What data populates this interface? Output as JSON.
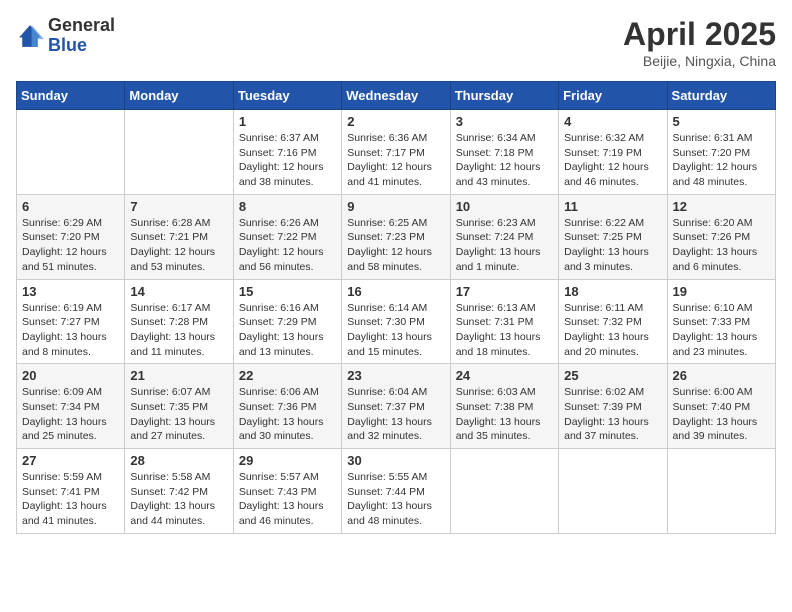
{
  "logo": {
    "general": "General",
    "blue": "Blue"
  },
  "title": "April 2025",
  "location": "Beijie, Ningxia, China",
  "days_of_week": [
    "Sunday",
    "Monday",
    "Tuesday",
    "Wednesday",
    "Thursday",
    "Friday",
    "Saturday"
  ],
  "weeks": [
    [
      {
        "day": "",
        "info": ""
      },
      {
        "day": "",
        "info": ""
      },
      {
        "day": "1",
        "info": "Sunrise: 6:37 AM\nSunset: 7:16 PM\nDaylight: 12 hours and 38 minutes."
      },
      {
        "day": "2",
        "info": "Sunrise: 6:36 AM\nSunset: 7:17 PM\nDaylight: 12 hours and 41 minutes."
      },
      {
        "day": "3",
        "info": "Sunrise: 6:34 AM\nSunset: 7:18 PM\nDaylight: 12 hours and 43 minutes."
      },
      {
        "day": "4",
        "info": "Sunrise: 6:32 AM\nSunset: 7:19 PM\nDaylight: 12 hours and 46 minutes."
      },
      {
        "day": "5",
        "info": "Sunrise: 6:31 AM\nSunset: 7:20 PM\nDaylight: 12 hours and 48 minutes."
      }
    ],
    [
      {
        "day": "6",
        "info": "Sunrise: 6:29 AM\nSunset: 7:20 PM\nDaylight: 12 hours and 51 minutes."
      },
      {
        "day": "7",
        "info": "Sunrise: 6:28 AM\nSunset: 7:21 PM\nDaylight: 12 hours and 53 minutes."
      },
      {
        "day": "8",
        "info": "Sunrise: 6:26 AM\nSunset: 7:22 PM\nDaylight: 12 hours and 56 minutes."
      },
      {
        "day": "9",
        "info": "Sunrise: 6:25 AM\nSunset: 7:23 PM\nDaylight: 12 hours and 58 minutes."
      },
      {
        "day": "10",
        "info": "Sunrise: 6:23 AM\nSunset: 7:24 PM\nDaylight: 13 hours and 1 minute."
      },
      {
        "day": "11",
        "info": "Sunrise: 6:22 AM\nSunset: 7:25 PM\nDaylight: 13 hours and 3 minutes."
      },
      {
        "day": "12",
        "info": "Sunrise: 6:20 AM\nSunset: 7:26 PM\nDaylight: 13 hours and 6 minutes."
      }
    ],
    [
      {
        "day": "13",
        "info": "Sunrise: 6:19 AM\nSunset: 7:27 PM\nDaylight: 13 hours and 8 minutes."
      },
      {
        "day": "14",
        "info": "Sunrise: 6:17 AM\nSunset: 7:28 PM\nDaylight: 13 hours and 11 minutes."
      },
      {
        "day": "15",
        "info": "Sunrise: 6:16 AM\nSunset: 7:29 PM\nDaylight: 13 hours and 13 minutes."
      },
      {
        "day": "16",
        "info": "Sunrise: 6:14 AM\nSunset: 7:30 PM\nDaylight: 13 hours and 15 minutes."
      },
      {
        "day": "17",
        "info": "Sunrise: 6:13 AM\nSunset: 7:31 PM\nDaylight: 13 hours and 18 minutes."
      },
      {
        "day": "18",
        "info": "Sunrise: 6:11 AM\nSunset: 7:32 PM\nDaylight: 13 hours and 20 minutes."
      },
      {
        "day": "19",
        "info": "Sunrise: 6:10 AM\nSunset: 7:33 PM\nDaylight: 13 hours and 23 minutes."
      }
    ],
    [
      {
        "day": "20",
        "info": "Sunrise: 6:09 AM\nSunset: 7:34 PM\nDaylight: 13 hours and 25 minutes."
      },
      {
        "day": "21",
        "info": "Sunrise: 6:07 AM\nSunset: 7:35 PM\nDaylight: 13 hours and 27 minutes."
      },
      {
        "day": "22",
        "info": "Sunrise: 6:06 AM\nSunset: 7:36 PM\nDaylight: 13 hours and 30 minutes."
      },
      {
        "day": "23",
        "info": "Sunrise: 6:04 AM\nSunset: 7:37 PM\nDaylight: 13 hours and 32 minutes."
      },
      {
        "day": "24",
        "info": "Sunrise: 6:03 AM\nSunset: 7:38 PM\nDaylight: 13 hours and 35 minutes."
      },
      {
        "day": "25",
        "info": "Sunrise: 6:02 AM\nSunset: 7:39 PM\nDaylight: 13 hours and 37 minutes."
      },
      {
        "day": "26",
        "info": "Sunrise: 6:00 AM\nSunset: 7:40 PM\nDaylight: 13 hours and 39 minutes."
      }
    ],
    [
      {
        "day": "27",
        "info": "Sunrise: 5:59 AM\nSunset: 7:41 PM\nDaylight: 13 hours and 41 minutes."
      },
      {
        "day": "28",
        "info": "Sunrise: 5:58 AM\nSunset: 7:42 PM\nDaylight: 13 hours and 44 minutes."
      },
      {
        "day": "29",
        "info": "Sunrise: 5:57 AM\nSunset: 7:43 PM\nDaylight: 13 hours and 46 minutes."
      },
      {
        "day": "30",
        "info": "Sunrise: 5:55 AM\nSunset: 7:44 PM\nDaylight: 13 hours and 48 minutes."
      },
      {
        "day": "",
        "info": ""
      },
      {
        "day": "",
        "info": ""
      },
      {
        "day": "",
        "info": ""
      }
    ]
  ]
}
